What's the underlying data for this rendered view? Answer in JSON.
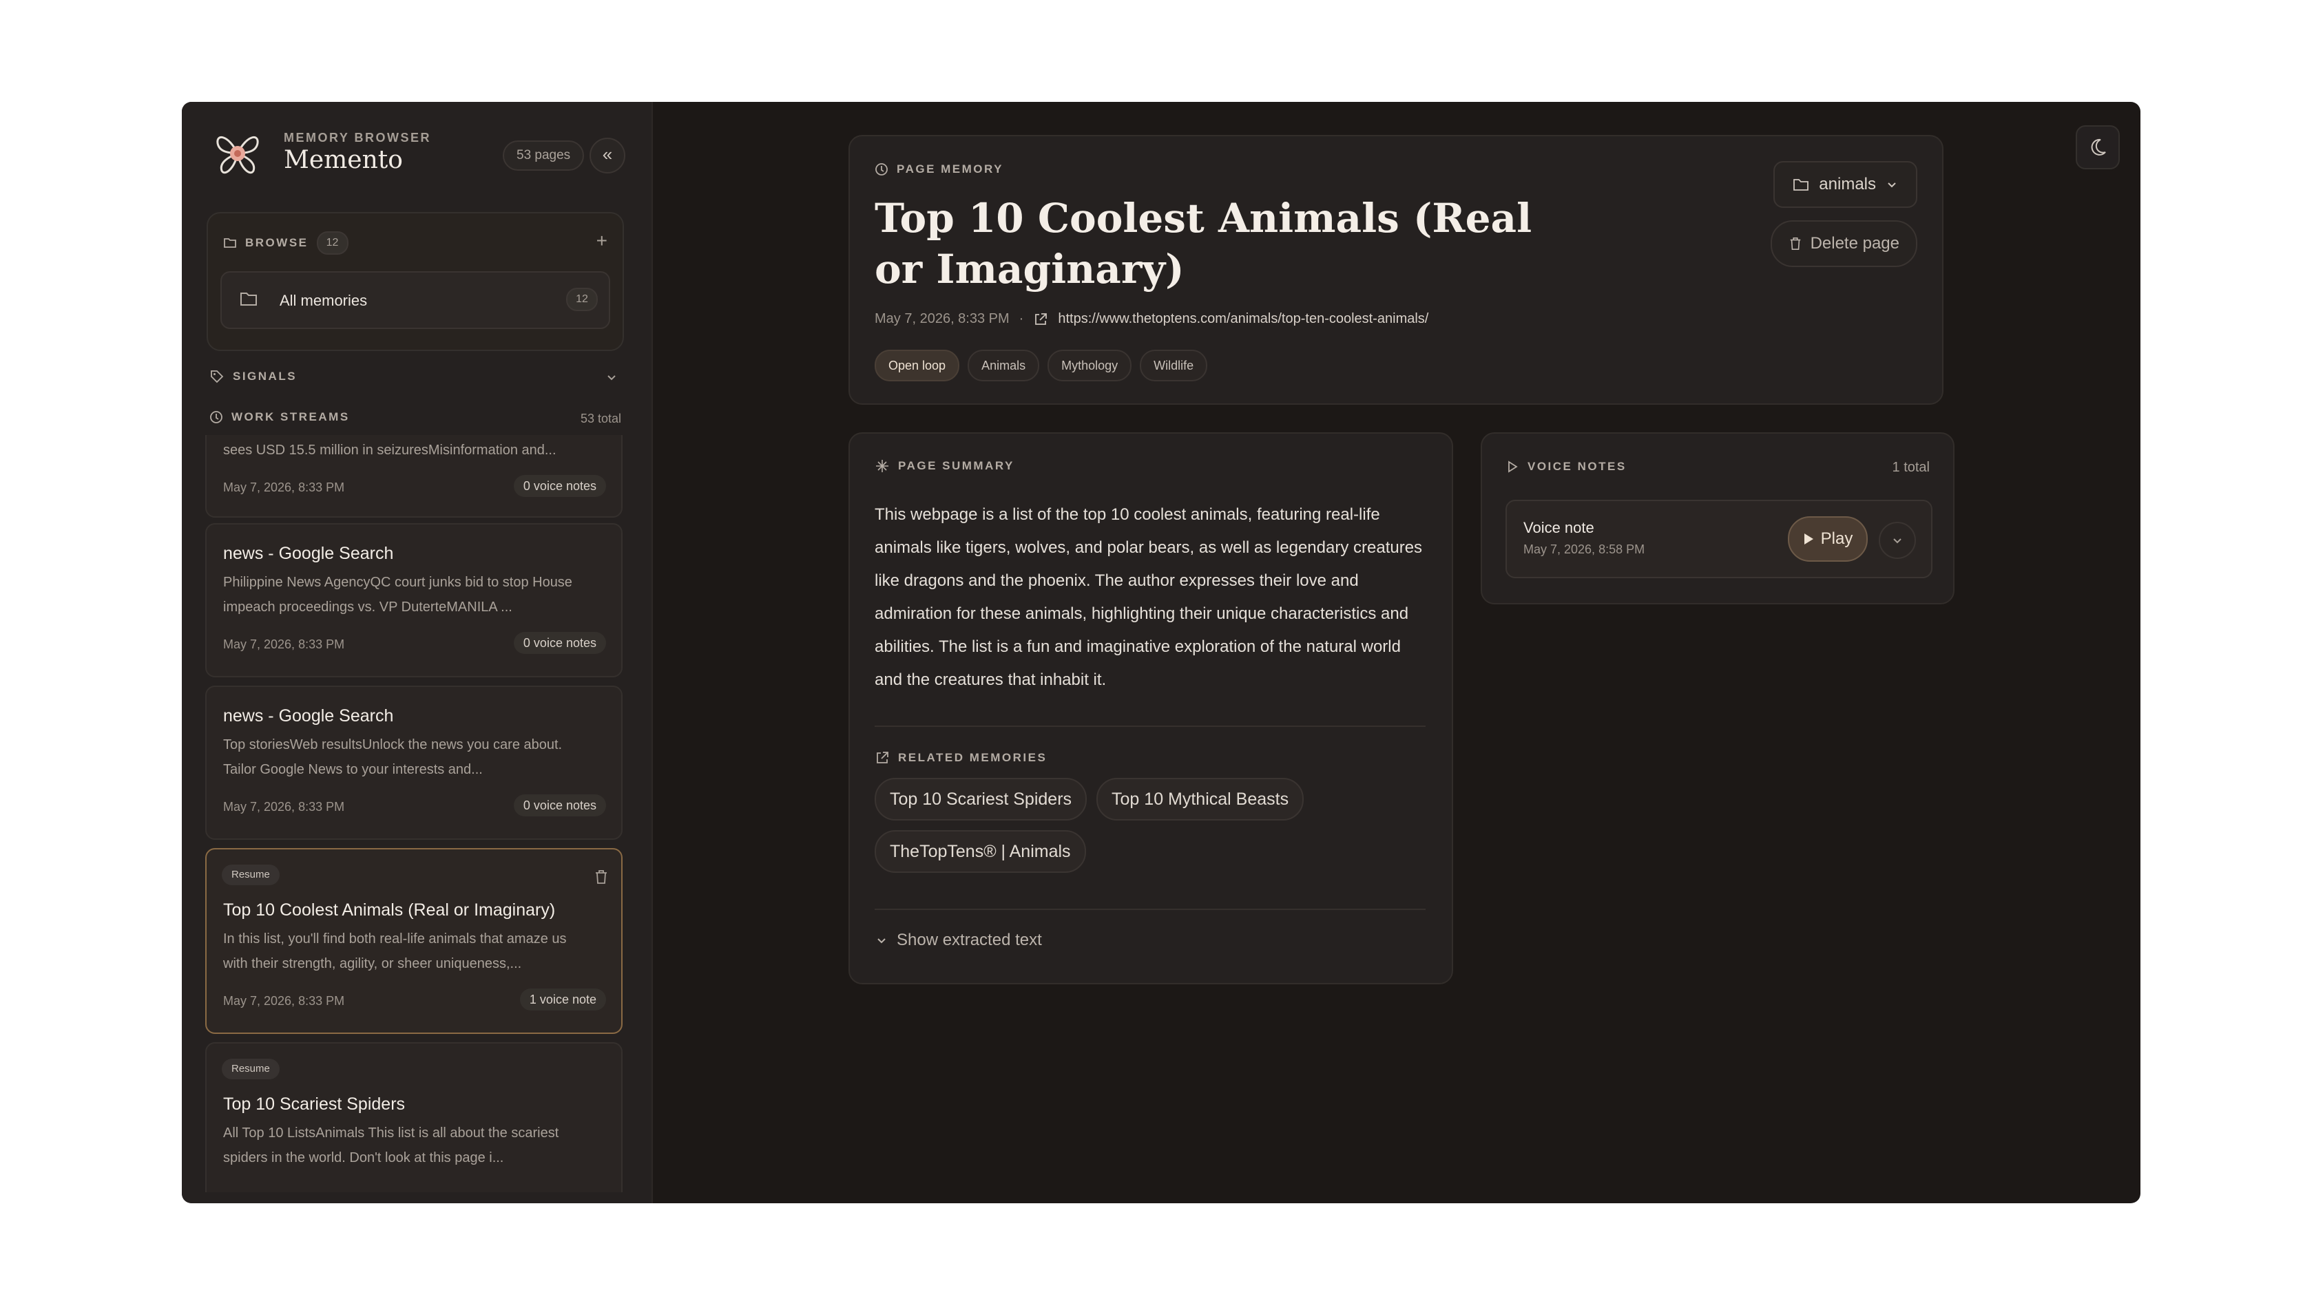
{
  "sidebar": {
    "kicker": "MEMORY BROWSER",
    "title": "Memento",
    "pages_badge": "53 pages",
    "collapse_glyph": "«",
    "browse": {
      "label": "BROWSE",
      "count": "12",
      "add_glyph": "+",
      "all_memories": {
        "label": "All memories",
        "count": "12"
      }
    },
    "signals_label": "SIGNALS",
    "work_streams": {
      "label": "WORK STREAMS",
      "total": "53 total"
    },
    "items": [
      {
        "tag": "",
        "title": "",
        "desc": "sees USD 15.5 million in seizuresMisinformation and...",
        "date": "May 7, 2026, 8:33 PM",
        "voice": "0 voice notes"
      },
      {
        "tag": "",
        "title": "news - Google Search",
        "desc": "Philippine News AgencyQC court junks bid to stop House impeach proceedings vs. VP DuterteMANILA ...",
        "date": "May 7, 2026, 8:33 PM",
        "voice": "0 voice notes"
      },
      {
        "tag": "",
        "title": "news - Google Search",
        "desc": "Top storiesWeb resultsUnlock the news you care about. Tailor Google News to your interests and...",
        "date": "May 7, 2026, 8:33 PM",
        "voice": "0 voice notes"
      },
      {
        "tag": "Resume",
        "title": "Top 10 Coolest Animals (Real or Imaginary)",
        "desc": "In this list, you'll find both real-life animals that amaze us with their strength, agility, or sheer uniqueness,...",
        "date": "May 7, 2026, 8:33 PM",
        "voice": "1 voice note"
      },
      {
        "tag": "Resume",
        "title": "Top 10 Scariest Spiders",
        "desc": "All Top 10 ListsAnimals This list is all about the scariest spiders in the world. Don't look at this page i...",
        "date": "",
        "voice": ""
      }
    ]
  },
  "page": {
    "kicker": "PAGE MEMORY",
    "title": "Top 10 Coolest Animals (Real or Imaginary)",
    "date": "May 7, 2026, 8:33 PM",
    "separator": "·",
    "url": "https://www.thetoptens.com/animals/top-ten-coolest-animals/",
    "tags": [
      "Open loop",
      "Animals",
      "Mythology",
      "Wildlife"
    ],
    "category": "animals",
    "delete_label": "Delete page"
  },
  "summary": {
    "kicker": "PAGE SUMMARY",
    "text": "This webpage is a list of the top 10 coolest animals, featuring real-life animals like tigers, wolves, and polar bears, as well as legendary creatures like dragons and the phoenix. The author expresses their love and admiration for these animals, highlighting their unique characteristics and abilities. The list is a fun and imaginative exploration of the natural world and the creatures that inhabit it.",
    "related_kicker": "RELATED MEMORIES",
    "related": [
      "Top 10 Scariest Spiders",
      "Top 10 Mythical Beasts",
      "TheTopTens® | Animals"
    ],
    "show_extracted": "Show extracted text"
  },
  "voice_notes": {
    "kicker": "VOICE NOTES",
    "total": "1 total",
    "note": {
      "title": "Voice note",
      "date": "May 7, 2026, 8:58 PM",
      "play_label": "Play"
    }
  },
  "colors": {
    "accent": "#8a6a44",
    "background": "#1c1816",
    "sidebar": "#252120"
  },
  "icons": [
    "logo-icon",
    "folder-icon",
    "tag-icon",
    "stream-icon",
    "trash-icon",
    "external-link-icon",
    "sparkle-icon",
    "play-icon",
    "moon-icon",
    "chevron-down-icon"
  ]
}
